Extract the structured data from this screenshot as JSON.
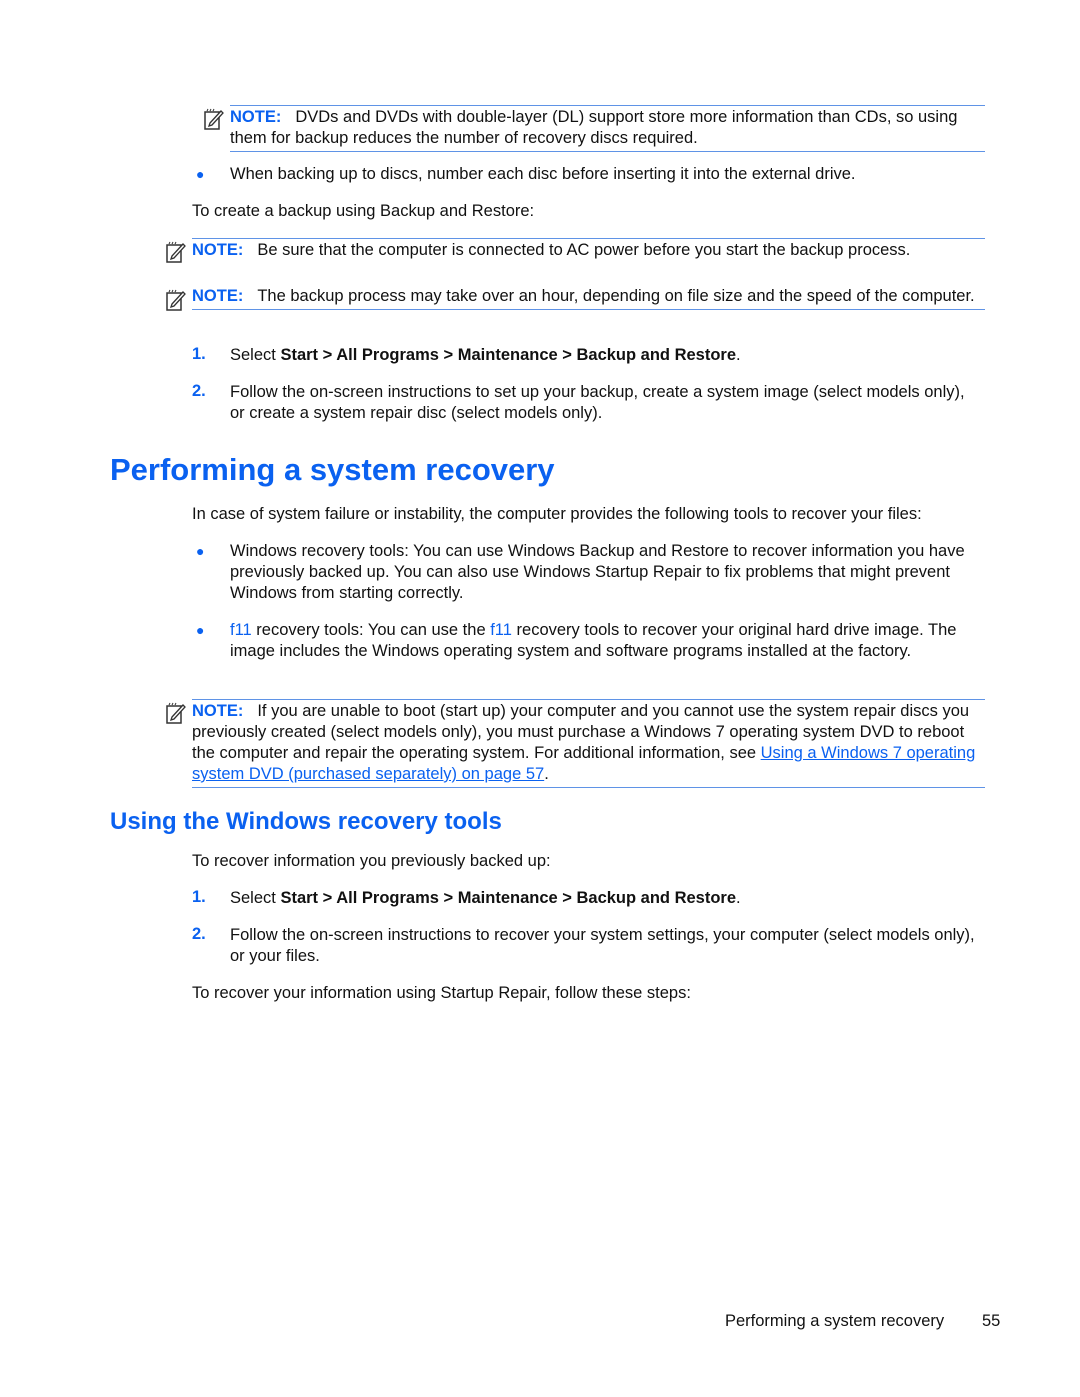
{
  "notes": {
    "label": "NOTE:",
    "note1": "DVDs and DVDs with double-layer (DL) support store more information than CDs, so using them for backup reduces the number of recovery discs required.",
    "note2": "Be sure that the computer is connected to AC power before you start the backup process.",
    "note3": "The backup process may take over an hour, depending on file size and the speed of the computer.",
    "note4_text": "If you are unable to boot (start up) your computer and you cannot use the system repair discs you previously created (select models only), you must purchase a Windows 7 operating system DVD to reboot the computer and repair the operating system. For additional information, see ",
    "note4_link": "Using a Windows 7 operating system DVD (purchased separately) on page 57",
    "note4_end": "."
  },
  "top_section": {
    "bullet1": "When backing up to discs, number each disc before inserting it into the external drive.",
    "intro": "To create a backup using Backup and Restore:",
    "steps": [
      {
        "num": "1.",
        "prefix": "Select ",
        "path": "Start > All Programs > Maintenance > Backup and Restore",
        "suffix": "."
      },
      {
        "num": "2.",
        "text": "Follow the on-screen instructions to set up your backup, create a system image (select models only), or create a system repair disc (select models only)."
      }
    ]
  },
  "recovery": {
    "heading": "Performing a system recovery",
    "intro": "In case of system failure or instability, the computer provides the following tools to recover your files:",
    "bullet1": "Windows recovery tools: You can use Windows Backup and Restore to recover information you have previously backed up. You can also use Windows Startup Repair to fix problems that might prevent Windows from starting correctly.",
    "bullet2_key": "f11",
    "bullet2_a": " recovery tools: You can use the ",
    "bullet2_b": " recovery tools to recover your original hard drive image. The image includes the Windows operating system and software programs installed at the factory."
  },
  "windows_tools": {
    "heading": "Using the Windows recovery tools",
    "intro": "To recover information you previously backed up:",
    "steps": [
      {
        "num": "1.",
        "prefix": "Select ",
        "path": "Start > All Programs > Maintenance > Backup and Restore",
        "suffix": "."
      },
      {
        "num": "2.",
        "text": "Follow the on-screen instructions to recover your system settings, your computer (select models only), or your files."
      }
    ],
    "outro": "To recover your information using Startup Repair, follow these steps:"
  },
  "footer": {
    "section": "Performing a system recovery",
    "page": "55"
  }
}
